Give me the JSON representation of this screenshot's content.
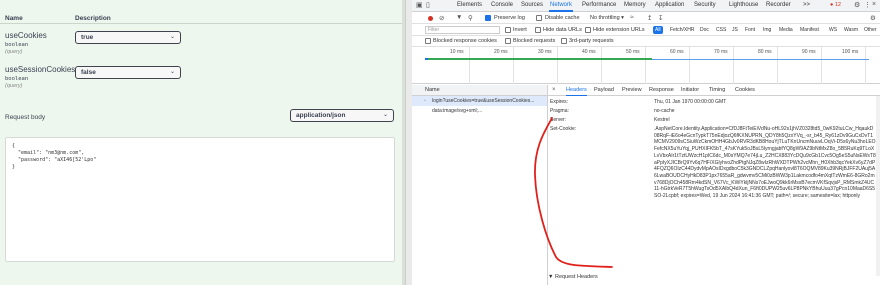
{
  "swagger": {
    "headers": {
      "name": "Name",
      "description": "Description"
    },
    "params": [
      {
        "name": "useCookies",
        "type": "boolean",
        "in": "(query)",
        "value": "true"
      },
      {
        "name": "useSessionCookies",
        "type": "boolean",
        "in": "(query)",
        "value": "false"
      }
    ],
    "request_body_label": "Request body",
    "content_type": "application/json",
    "body": "{\n  \"email\": \"nm3@nm.com\",\n  \"password\": \"aXI46[52'Lpo\"\n}"
  },
  "devtools": {
    "tabs": [
      "Elements",
      "Console",
      "Sources",
      "Network",
      "Performance",
      "Memory",
      "Application",
      "Security",
      "Lighthouse",
      "Recorder"
    ],
    "active_tab": "Network",
    "more_tabs": ">>",
    "issue_badge": "12",
    "toolbar": {
      "preserve_log": "Preserve log",
      "disable_cache": "Disable cache",
      "throttling": "No throttling"
    },
    "filter": {
      "placeholder": "Filter",
      "invert": "Invert",
      "hide_data_urls": "Hide data URLs",
      "hide_extension_urls": "Hide extension URLs",
      "types": [
        "All",
        "Fetch/XHR",
        "Doc",
        "CSS",
        "JS",
        "Font",
        "Img",
        "Media",
        "Manifest",
        "WS",
        "Wasm",
        "Other"
      ],
      "active_type": "All",
      "blocked_response_cookies": "Blocked response cookies",
      "blocked_requests": "Blocked requests",
      "third_party": "3rd-party requests"
    },
    "overview_ticks": [
      "10 ms",
      "20 ms",
      "30 ms",
      "40 ms",
      "50 ms",
      "60 ms",
      "70 ms",
      "80 ms",
      "90 ms",
      "100 ms"
    ],
    "list": {
      "header": "Name",
      "rows": [
        "login?useCookies=true&useSessionCookies...",
        "data:image/svg+xml;..."
      ]
    },
    "details": {
      "close": "×",
      "tabs": [
        "Headers",
        "Payload",
        "Preview",
        "Response",
        "Initiator",
        "Timing",
        "Cookies"
      ],
      "active_tab": "Headers",
      "headers": [
        {
          "name": "Expires:",
          "value": "Thu, 01 Jan 1970 00:00:00 GMT"
        },
        {
          "name": "Pragma:",
          "value": "no-cache"
        },
        {
          "name": "Server:",
          "value": "Kestrel"
        },
        {
          "name": "Set-Cookie:",
          "value": ".AspNetCore.Identity.Application=CfDJ8FtTeiEiVdNu-oHL92s1jhVZ0328td5_0wK92tuLCw_HqaukD08RqF-iE6o4eGcnTypkT75nEdjozQ6fKXNUPRN_QDY8h5QzxYVq_-sr_b45_Ry61zDv9GuCxDvT1MCMV2909sCSiuWzCkmOHH4GbJv0RVR3dKB8HouYjTLuTKnUncmNuuvLOqVi-D5s6yNu3hoLEOFefcNX5uYuYqj_PUHXIFK5bT_47sKYuk5oJBsL5lyrngjabfYQ8gW9AZ9bNtMxZ8o_5B5RuKq9TLoXLvVbxAIr1tTztUWzcH1pIC6dc_M0sYMQ7e74jLu_Z2HCX883YcDQu9cGb1Cvc5Og5eS5uNsEWsT8aPpIyXJICBrQ9Yv6q7HF/XGlyhvoZhdPtgNJqZ8wIzRhWXDTPWh2vcMhn_H0Xhb3qcYekXv6yZ7dP4FQZQ6OIzC44DydvMpAOsIDxgdboC5k3GNDCLZpqHanlyovl8T6OQMV89Ku39NRjBJFF2UAuj5A6LwaBOUDCHyHkD83P1px7655aR_gdwvmv5CMi0zBWW3p1Lakmcodfo4mXqtTzWmE6-8GRo2mv768DjOCh458Rm4kdSN_V67Vc_KWiYkljNNs7oEJwoQ9kk6rMsxB7ecmVKfSqvjsP_RMSmkZ4UC11-hGtrkVeR7T5hWugTsOd5XAlbQ4dXun_F6ft0DUPW25uv6LP8PNkYBhuUuu37gPcn10MaaD6S5SO-2Lcpbf; expires=Wed, 19 Jun 2024 16:41:36 GMT; path=/; secure; samesite=lax; httponly"
        }
      ],
      "request_headers": "▼ Request Headers"
    }
  }
}
